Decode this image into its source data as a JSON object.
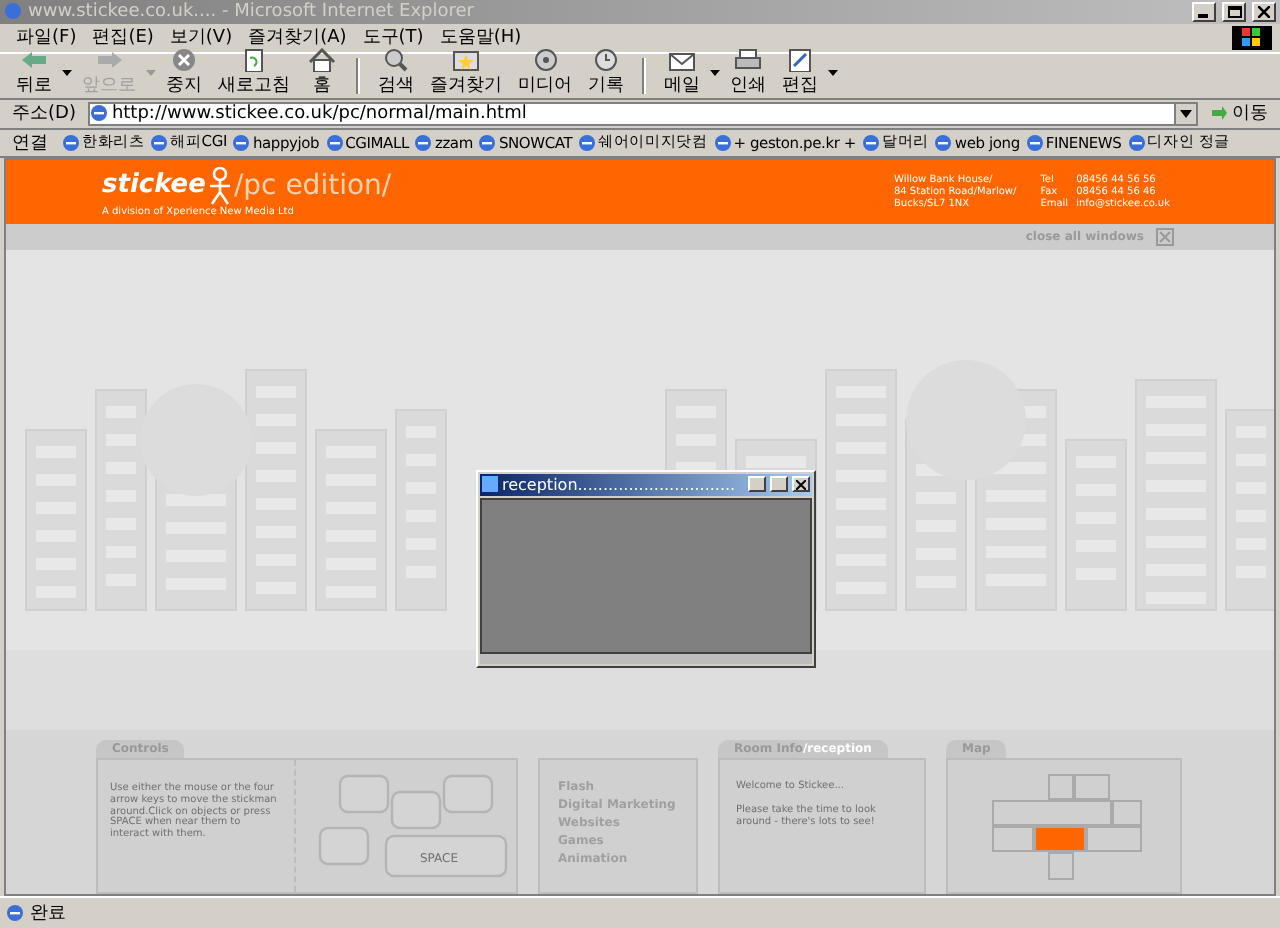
{
  "window": {
    "title": "www.stickee.co.uk.... - Microsoft Internet Explorer"
  },
  "menu": [
    "파일(F)",
    "편집(E)",
    "보기(V)",
    "즐겨찾기(A)",
    "도구(T)",
    "도움말(H)"
  ],
  "toolbar": [
    {
      "label": "뒤로",
      "disabled": false,
      "dropdown": true
    },
    {
      "label": "앞으로",
      "disabled": true,
      "dropdown": true
    },
    {
      "label": "중지",
      "disabled": false,
      "dropdown": false
    },
    {
      "label": "새로고침",
      "disabled": false,
      "dropdown": false
    },
    {
      "label": "홈",
      "disabled": false,
      "dropdown": false
    },
    {
      "label": "검색",
      "disabled": false,
      "dropdown": false
    },
    {
      "label": "즐겨찾기",
      "disabled": false,
      "dropdown": false
    },
    {
      "label": "미디어",
      "disabled": false,
      "dropdown": false
    },
    {
      "label": "기록",
      "disabled": false,
      "dropdown": false
    },
    {
      "label": "메일",
      "disabled": false,
      "dropdown": true
    },
    {
      "label": "인쇄",
      "disabled": false,
      "dropdown": false
    },
    {
      "label": "편집",
      "disabled": false,
      "dropdown": true
    }
  ],
  "address": {
    "label": "주소(D)",
    "value": "http://www.stickee.co.uk/pc/normal/main.html",
    "go": "이동"
  },
  "links": {
    "label": "연결",
    "items": [
      "한화리츠",
      "해피CGI",
      "happyjob",
      "CGIMALL",
      "zzam",
      "SNOWCAT",
      "쉐어이미지닷컴",
      "+ geston.pe.kr +",
      "달머리",
      "web jong",
      "FINENEWS",
      "디자인 정글"
    ]
  },
  "site": {
    "logo": "stickee",
    "edition": "/pc edition/",
    "tagline": "A division of Xperience New Media Ltd",
    "postal": [
      "Willow Bank House/",
      "84 Station Road/Marlow/",
      "Bucks/SL7 1NX"
    ],
    "contacts": [
      {
        "label": "Tel",
        "value": "08456 44 56 56"
      },
      {
        "label": "Fax",
        "value": "08456 44 56 46"
      },
      {
        "label": "Email",
        "value": "info@stickee.co.uk"
      }
    ],
    "close_all": "close all windows"
  },
  "popup": {
    "title": "reception..............................."
  },
  "controls": {
    "tab": "Controls",
    "text": "Use either the mouse or the four arrow keys to move the stickman around.Click on objects or press SPACE when near them to interact with them.",
    "key_label": "SPACE"
  },
  "services": [
    "Flash",
    "Digital Marketing",
    "Websites",
    "Games",
    "Animation"
  ],
  "room_info": {
    "tab": "Room Info",
    "room": "/reception",
    "welcome": "Welcome to Stickee...",
    "text": "Please take the time to look around - there's lots to see!"
  },
  "map": {
    "tab": "Map",
    "rooms": [
      {
        "selected": false
      },
      {
        "selected": false
      },
      {
        "selected": false
      },
      {
        "selected": false
      },
      {
        "selected": false
      },
      {
        "selected": true
      },
      {
        "selected": false
      },
      {
        "selected": false
      }
    ]
  },
  "status": {
    "text": "완료"
  }
}
